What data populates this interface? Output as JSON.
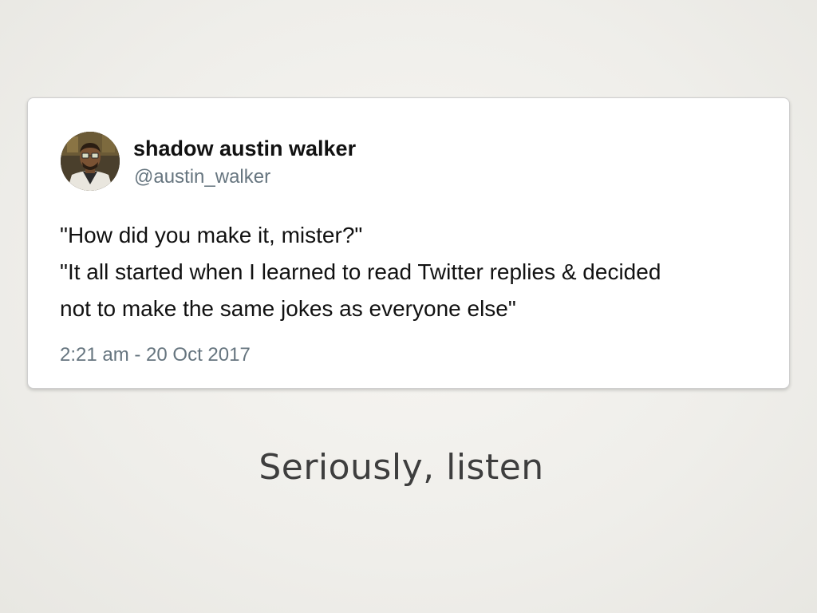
{
  "tweet": {
    "display_name": "shadow austin walker",
    "handle": "@austin_walker",
    "text_lines": [
      "\"How did you make it, mister?\"",
      "\"It all started when I learned to read Twitter replies & decided",
      "not to make the same jokes as everyone else\""
    ],
    "timestamp": "2:21 am - 20 Oct 2017",
    "avatar_icon": "cartoon-man-with-glasses-avatar"
  },
  "slide": {
    "caption": "Seriously, listen"
  },
  "colors": {
    "card_background": "#ffffff",
    "name_text": "#111111",
    "secondary_text": "#66757f",
    "caption_text": "#3e3e3e",
    "slide_background": "#efeeea"
  }
}
